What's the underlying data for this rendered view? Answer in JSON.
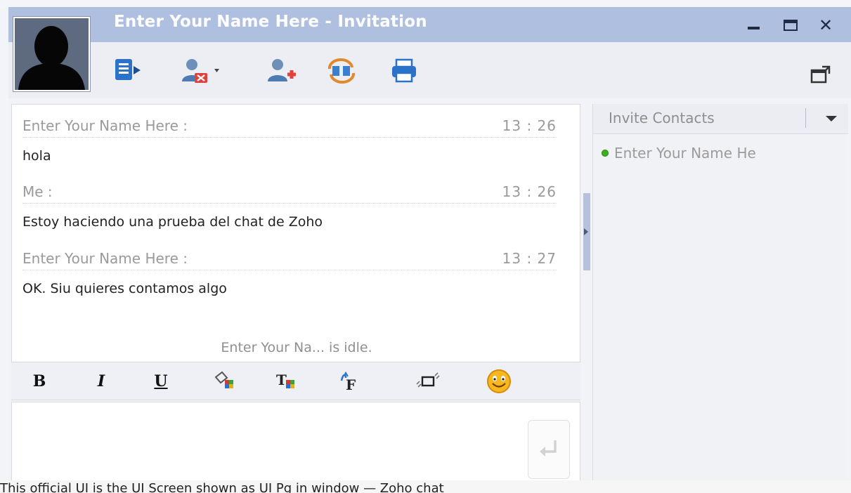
{
  "window": {
    "title": "Enter Your Name Here - Invitation"
  },
  "toolbar": {
    "icons": [
      "send-file-icon",
      "remove-user-icon",
      "add-user-icon",
      "exchange-icon",
      "print-icon",
      "popout-icon"
    ]
  },
  "chat": {
    "messages": [
      {
        "sender": "Enter Your Name Here :",
        "time": "13 : 26",
        "text": "hola"
      },
      {
        "sender": "Me :",
        "time": "13 : 26",
        "text": "Estoy haciendo una prueba del chat de Zoho"
      },
      {
        "sender": "Enter Your Name Here :",
        "time": "13 : 27",
        "text": "OK. Siu quieres contamos algo"
      }
    ],
    "status": "Enter Your Na... is idle."
  },
  "format": {
    "bold": "B",
    "italic": "I",
    "underline": "U"
  },
  "input": {
    "value": ""
  },
  "sidebar": {
    "dropdown_label": "Invite Contacts",
    "contacts": [
      {
        "name": "Enter Your Name He",
        "status_color": "#3db01e"
      }
    ]
  },
  "colors": {
    "titlebar": "#aebfe0",
    "toolbar_icon_blue": "#2a73c8",
    "online": "#3db01e"
  },
  "caption": "This official UI is the UI Screen shown as UI Pg in window — Zoho chat"
}
